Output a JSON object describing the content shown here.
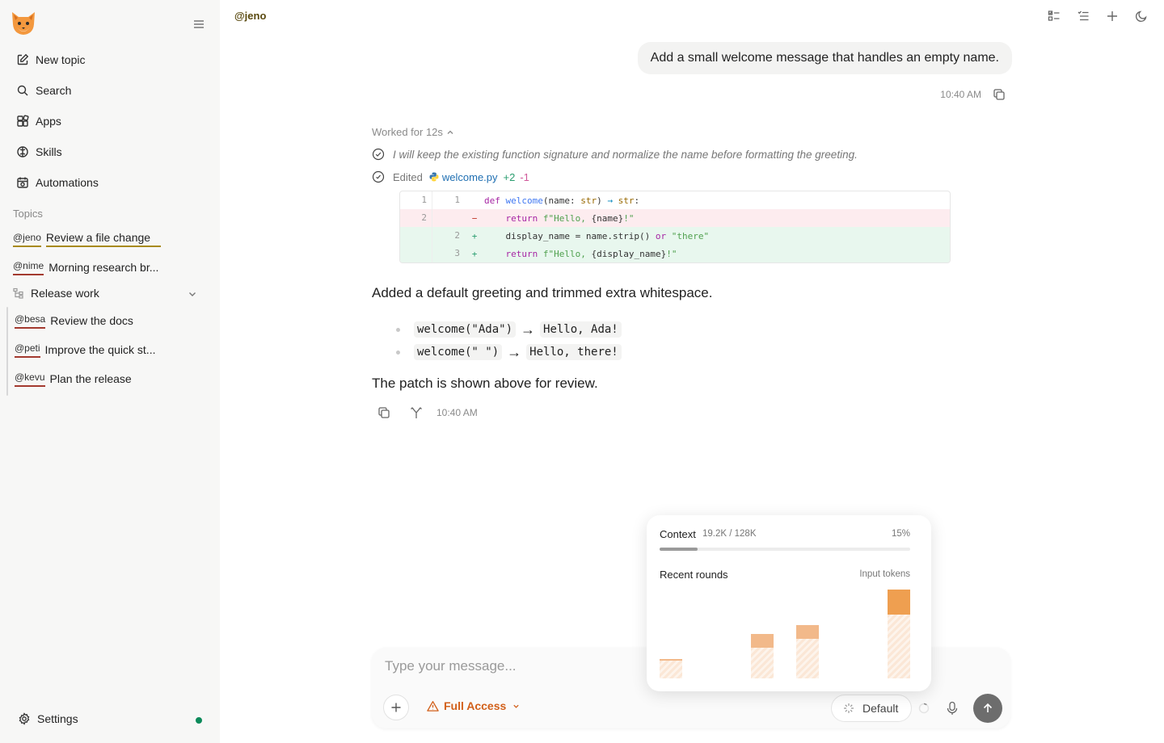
{
  "sidebar": {
    "nav": [
      {
        "label": "New topic",
        "icon": "edit-icon"
      },
      {
        "label": "Search",
        "icon": "search-icon"
      },
      {
        "label": "Apps",
        "icon": "apps-icon"
      },
      {
        "label": "Skills",
        "icon": "skills-icon"
      },
      {
        "label": "Automations",
        "icon": "automations-icon"
      }
    ],
    "topics_label": "Topics",
    "topics": [
      {
        "handle": "@jeno",
        "title": "Review a file change",
        "active": true
      },
      {
        "handle": "@nime",
        "title": "Morning research br..."
      }
    ],
    "group": {
      "label": "Release work",
      "items": [
        {
          "handle": "@besa",
          "title": "Review the docs"
        },
        {
          "handle": "@peti",
          "title": "Improve the quick st..."
        },
        {
          "handle": "@kevu",
          "title": "Plan the release"
        }
      ]
    },
    "settings_label": "Settings",
    "status_color": "#0c8a5a"
  },
  "header": {
    "title": "@jeno"
  },
  "chat": {
    "user_message": "Add a small welcome message that handles an empty name.",
    "user_time": "10:40 AM",
    "worked_label": "Worked for 12s",
    "thought": "I will keep the existing function signature and normalize the name before formatting the greeting.",
    "edited_label": "Edited",
    "edited_file": "welcome.py",
    "edited_adds": "+2",
    "edited_dels": "-1",
    "diff": [
      {
        "old": "1",
        "new": "1",
        "sign": "",
        "type": "ctx",
        "code": "def welcome(name: str) → str:"
      },
      {
        "old": "2",
        "new": "",
        "sign": "−",
        "type": "del",
        "code": "    return f\"Hello, {name}!\""
      },
      {
        "old": "",
        "new": "2",
        "sign": "+",
        "type": "add",
        "code": "    display_name = name.strip() or \"there\""
      },
      {
        "old": "",
        "new": "3",
        "sign": "+",
        "type": "add",
        "code": "    return f\"Hello, {display_name}!\""
      }
    ],
    "answer_intro": "Added a default greeting and trimmed extra whitespace.",
    "examples": [
      {
        "call": "welcome(\"Ada\")",
        "arrow": "→",
        "result": "Hello, Ada!"
      },
      {
        "call": "welcome(\" \")",
        "arrow": "→",
        "result": "Hello, there!"
      }
    ],
    "answer_outro": "The patch is shown above for review.",
    "answer_time": "10:40 AM"
  },
  "composer": {
    "placeholder": "Type your message...",
    "access_label": "Full Access",
    "model_label": "Default",
    "accent": "#d2601a"
  },
  "context_popover": {
    "label": "Context",
    "value": "19.2K / 128K",
    "percent_label": "15%",
    "percent": 0.15,
    "rounds_label": "Recent rounds",
    "tokens_label": "Input tokens",
    "rounds": [
      {
        "input": 0.22,
        "output": 0.2
      },
      {
        "input": 0.0,
        "output": 0.0
      },
      {
        "input": 0.5,
        "output": 0.35
      },
      {
        "input": 0.6,
        "output": 0.45
      },
      {
        "input": 0.0,
        "output": 0.0
      },
      {
        "input": 1.0,
        "output": 0.72
      }
    ]
  }
}
